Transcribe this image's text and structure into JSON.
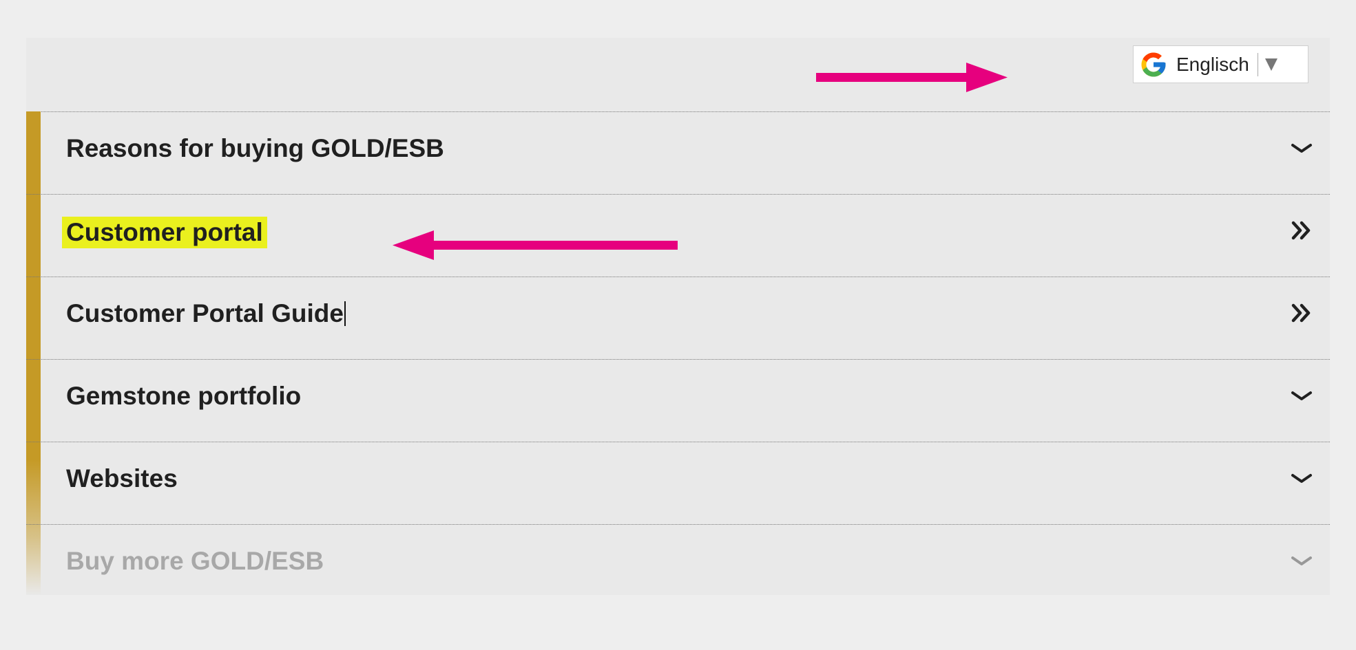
{
  "language_selector": {
    "label": "Englisch",
    "icon": "google-g-icon"
  },
  "colors": {
    "accent": "#c59a26",
    "highlight": "#eaf01e",
    "annotation_arrow": "#e6007e"
  },
  "menu": {
    "items": [
      {
        "label": "Reasons for buying GOLD/ESB",
        "icon": "chevron-down-icon"
      },
      {
        "label": "Customer portal",
        "icon": "double-chevron-right-icon",
        "highlighted": true
      },
      {
        "label": "Customer Portal Guide",
        "icon": "double-chevron-right-icon"
      },
      {
        "label": "Gemstone portfolio",
        "icon": "chevron-down-icon"
      },
      {
        "label": "Websites",
        "icon": "chevron-down-icon"
      },
      {
        "label": "Buy more GOLD/ESB",
        "icon": "chevron-down-icon"
      }
    ]
  }
}
